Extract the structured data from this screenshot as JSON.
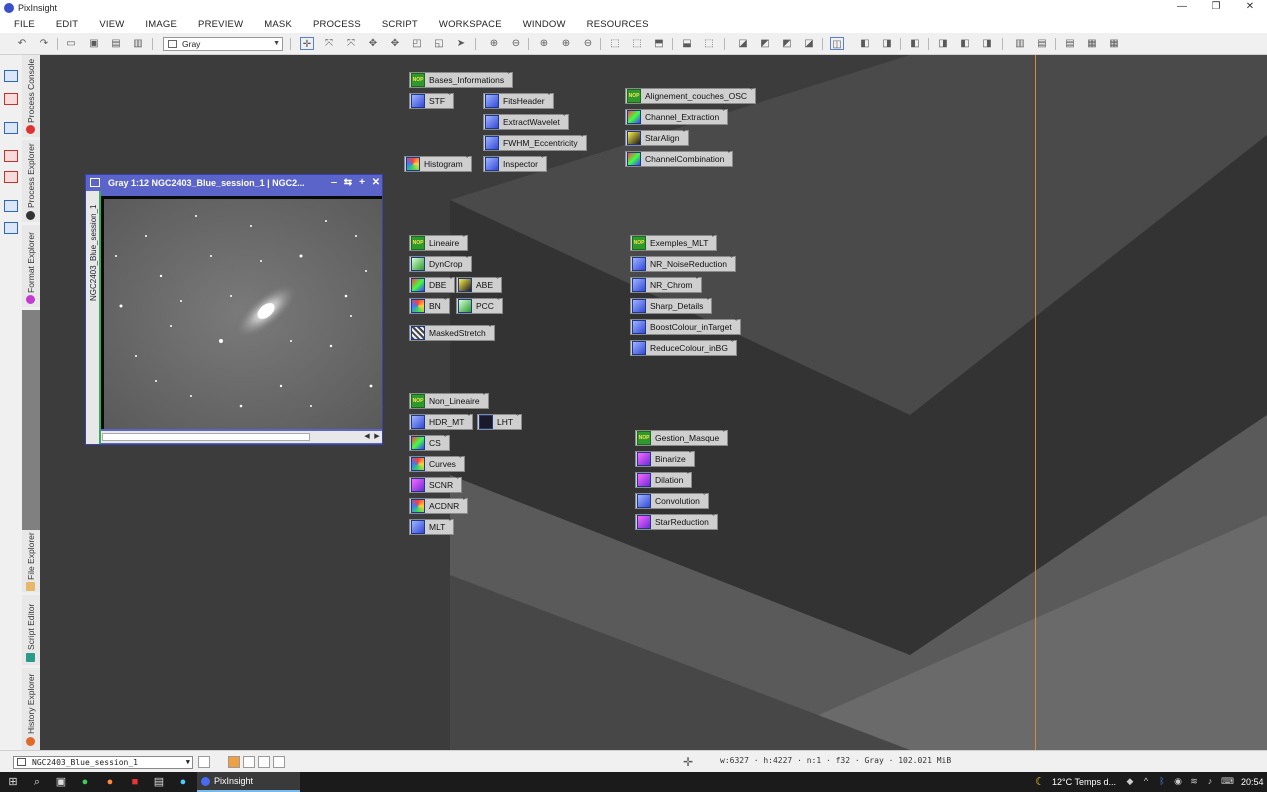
{
  "window": {
    "title": "PixInsight",
    "controls": [
      "—",
      "❐",
      "✕"
    ]
  },
  "menu": [
    "FILE",
    "EDIT",
    "VIEW",
    "IMAGE",
    "PREVIEW",
    "MASK",
    "PROCESS",
    "SCRIPT",
    "WORKSPACE",
    "WINDOW",
    "RESOURCES"
  ],
  "toolbar": {
    "view_mode": "Gray"
  },
  "sidebar": {
    "tabs": [
      "Process Console",
      "Process Explorer",
      "Format Explorer",
      "File Explorer",
      "Script Editor",
      "History Explorer"
    ]
  },
  "image_window": {
    "title": "Gray 1:12 NGC2403_Blue_session_1 | NGC2...",
    "side_label": "NGC2403_Blue_session_1",
    "buttons": [
      "‒",
      "⇆",
      "+",
      "✕"
    ]
  },
  "process_icons": [
    {
      "label": "Bases_Informations",
      "icon": "nop-icon"
    },
    {
      "label": "STF",
      "icon": "stf-icon"
    },
    {
      "label": "FitsHeader",
      "icon": "fitsheader-icon"
    },
    {
      "label": "ExtractWavelet",
      "icon": "script-icon"
    },
    {
      "label": "FWHM_Eccentricity",
      "icon": "script-icon"
    },
    {
      "label": "Histogram",
      "icon": "histogram-icon"
    },
    {
      "label": "Inspector",
      "icon": "script-icon"
    },
    {
      "label": "Alignement_couches_OSC",
      "icon": "nop-icon"
    },
    {
      "label": "Channel_Extraction",
      "icon": "channel-icon"
    },
    {
      "label": "StarAlign",
      "icon": "staralign-icon"
    },
    {
      "label": "ChannelCombination",
      "icon": "channel-icon"
    },
    {
      "label": "Lineaire",
      "icon": "nop-icon"
    },
    {
      "label": "DynCrop",
      "icon": "crop-icon"
    },
    {
      "label": "DBE",
      "icon": "dbe-icon"
    },
    {
      "label": "ABE",
      "icon": "abe-icon"
    },
    {
      "label": "BN",
      "icon": "bn-icon"
    },
    {
      "label": "PCC",
      "icon": "pcc-icon"
    },
    {
      "label": "MaskedStretch",
      "icon": "maskedstretch-icon"
    },
    {
      "label": "Exemples_MLT",
      "icon": "nop-icon"
    },
    {
      "label": "NR_NoiseReduction",
      "icon": "mlt-icon"
    },
    {
      "label": "NR_Chrom",
      "icon": "mlt-icon"
    },
    {
      "label": "Sharp_Details",
      "icon": "mlt-icon"
    },
    {
      "label": "BoostColour_inTarget",
      "icon": "mlt-icon"
    },
    {
      "label": "ReduceColour_inBG",
      "icon": "mlt-icon"
    },
    {
      "label": "Non_Lineaire",
      "icon": "nop-icon"
    },
    {
      "label": "HDR_MT",
      "icon": "hdrmt-icon"
    },
    {
      "label": "LHT",
      "icon": "lht-icon"
    },
    {
      "label": "CS",
      "icon": "cs-icon"
    },
    {
      "label": "Curves",
      "icon": "curves-icon"
    },
    {
      "label": "SCNR",
      "icon": "scnr-icon"
    },
    {
      "label": "ACDNR",
      "icon": "acdnr-icon"
    },
    {
      "label": "MLT",
      "icon": "mlt-icon"
    },
    {
      "label": "Gestion_Masque",
      "icon": "nop-icon"
    },
    {
      "label": "Binarize",
      "icon": "binarize-icon"
    },
    {
      "label": "Dilation",
      "icon": "dilation-icon"
    },
    {
      "label": "Convolution",
      "icon": "convolution-icon"
    },
    {
      "label": "StarReduction",
      "icon": "starreduction-icon"
    }
  ],
  "nop_text": "NOP",
  "statusbar": {
    "view": "NGC2403_Blue_session_1",
    "info": "w:6327 · h:4227 · n:1 · f32 · Gray · 102.021 MiB"
  },
  "taskbar": {
    "app": "PixInsight",
    "weather": "12°C  Temps d...",
    "time": "20:54"
  }
}
